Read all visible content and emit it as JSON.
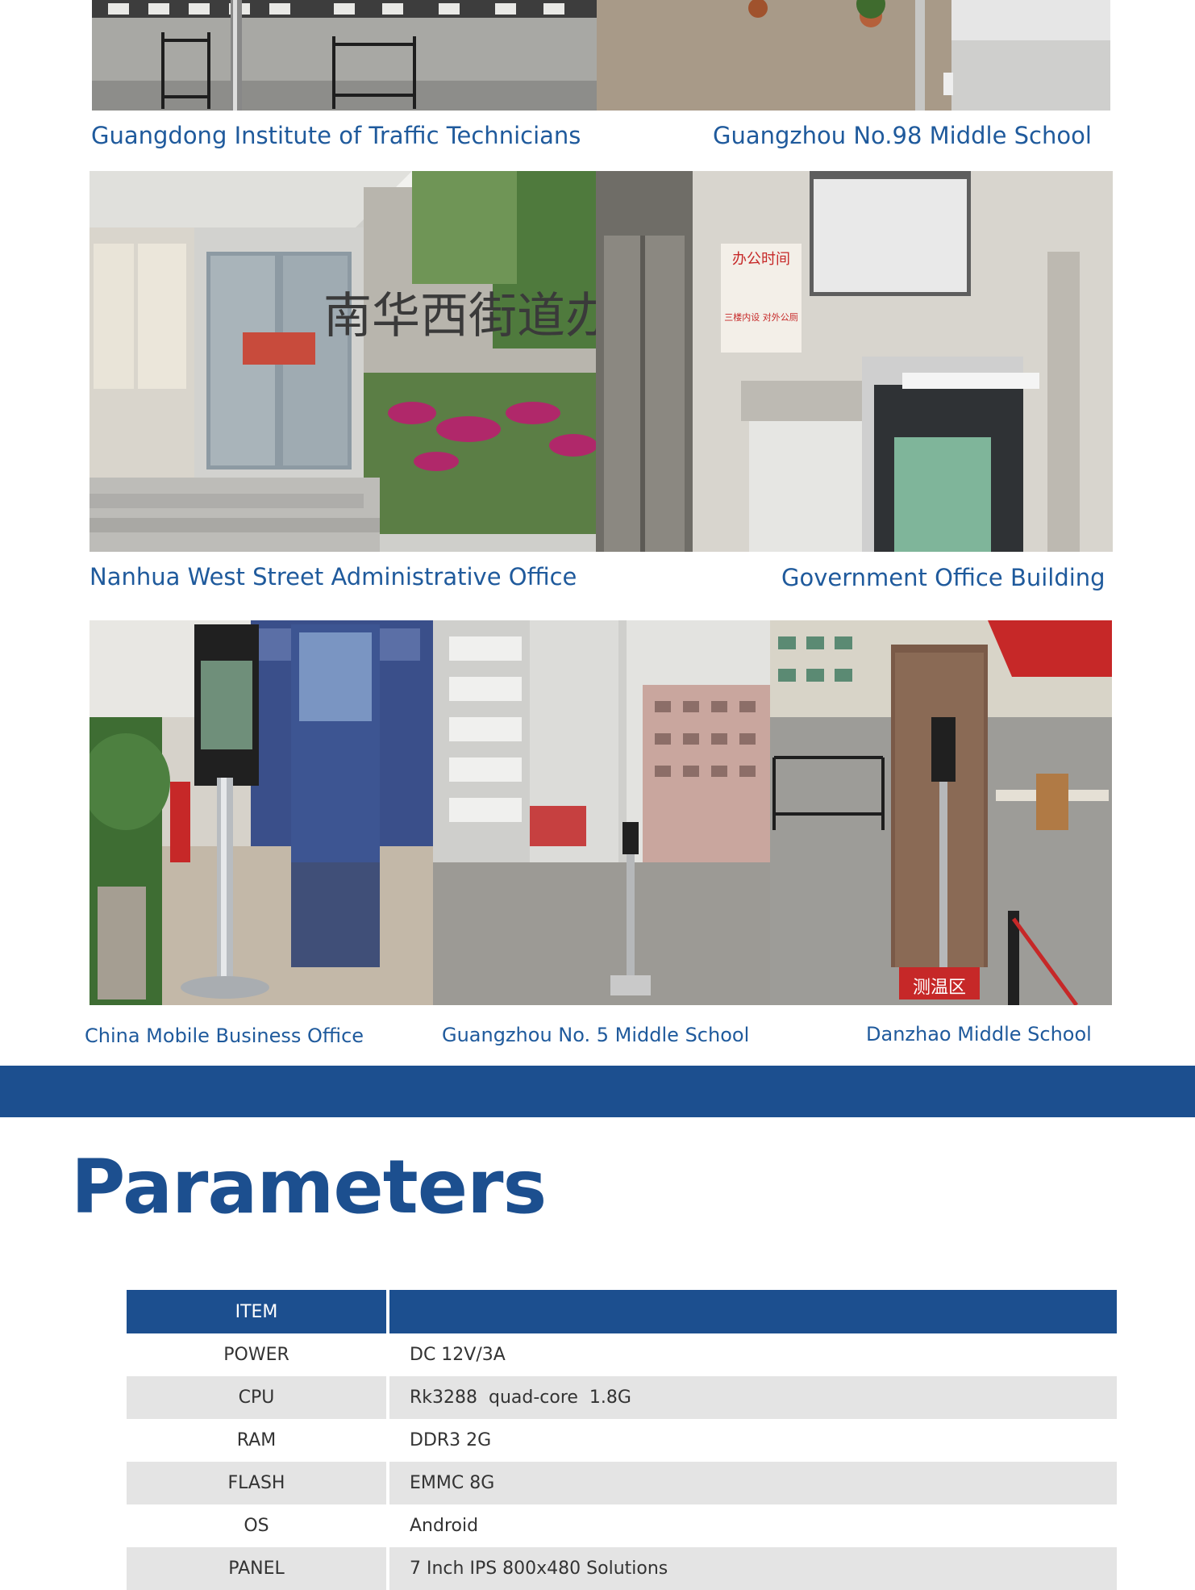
{
  "gallery": {
    "row1": [
      {
        "caption": "Guangdong Institute of Traffic Technicians"
      },
      {
        "caption": "Guangzhou No.98 Middle School"
      }
    ],
    "row2": [
      {
        "caption": "Nanhua West Street Administrative Office",
        "sign_text": "南华西街道办"
      },
      {
        "caption": "Government Office Building",
        "notice_title": "办公时间",
        "notice_sub": "三楼内设 对外公厕"
      }
    ],
    "row3": [
      {
        "caption": "China Mobile Business Office"
      },
      {
        "caption": "Guangzhou No. 5 Middle School"
      },
      {
        "caption": "Danzhao Middle School",
        "sign_text": "测温区"
      }
    ]
  },
  "section": {
    "title": "Parameters"
  },
  "colors": {
    "brand_blue": "#1c4f8f",
    "caption_blue": "#1f5a9c",
    "row_alt": "#e4e4e4"
  },
  "params_table": {
    "header": {
      "item": "ITEM",
      "value": ""
    },
    "rows": [
      {
        "item": "POWER",
        "value": "DC 12V/3A"
      },
      {
        "item": "CPU",
        "value": "Rk3288  quad-core  1.8G"
      },
      {
        "item": "RAM",
        "value": "DDR3 2G"
      },
      {
        "item": "FLASH",
        "value": "EMMC 8G"
      },
      {
        "item": "OS",
        "value": "Android"
      },
      {
        "item": "PANEL",
        "value": "7 Inch IPS 800x480 Solutions"
      }
    ]
  }
}
